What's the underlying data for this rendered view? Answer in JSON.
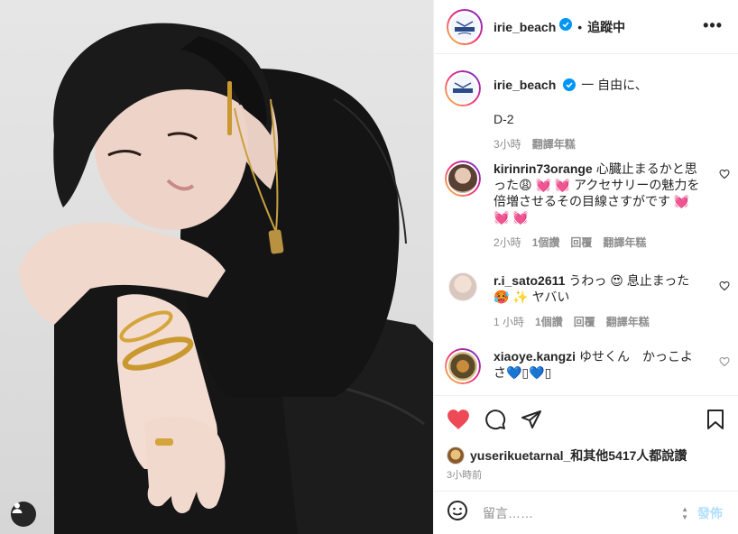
{
  "post": {
    "username": "irie_beach",
    "follow_label": "追蹤中",
    "more_label": "•••",
    "caption_dash": "一 自由に、",
    "caption_line2": "D-2",
    "caption_time": "3小時",
    "caption_translate": "翻譯年糕"
  },
  "comments": [
    {
      "username": "kirinrin73orange",
      "text": "心臓止まるかと思った😩 💓 💓 アクセサリーの魅力を倍増させるその目線さすがです 💓 💓 💓",
      "time": "2小時",
      "likes": "1個讚",
      "reply": "回覆",
      "translate": "翻譯年糕"
    },
    {
      "username": "r.i_sato2611",
      "text": "うわっ 😍 息止まった 🥵 ✨ ヤバい",
      "time": "1 小時",
      "likes": "1個讚",
      "reply": "回覆",
      "translate": "翻譯年糕"
    },
    {
      "username": "xiaoye.kangzi",
      "text": "ゆせくん　かっこよさ💙▯💙▯",
      "time": "",
      "likes": "",
      "reply": "",
      "translate": ""
    }
  ],
  "likes_text": "yuserikuetarnal_和其他5417人都說讚",
  "posted_time": "3小時前",
  "comment_box": {
    "placeholder": "留言……",
    "post_label": "發佈"
  },
  "colors": {
    "like_red": "#ed4956",
    "verified_blue": "#0095f6",
    "post_disabled": "#b2dffc"
  }
}
